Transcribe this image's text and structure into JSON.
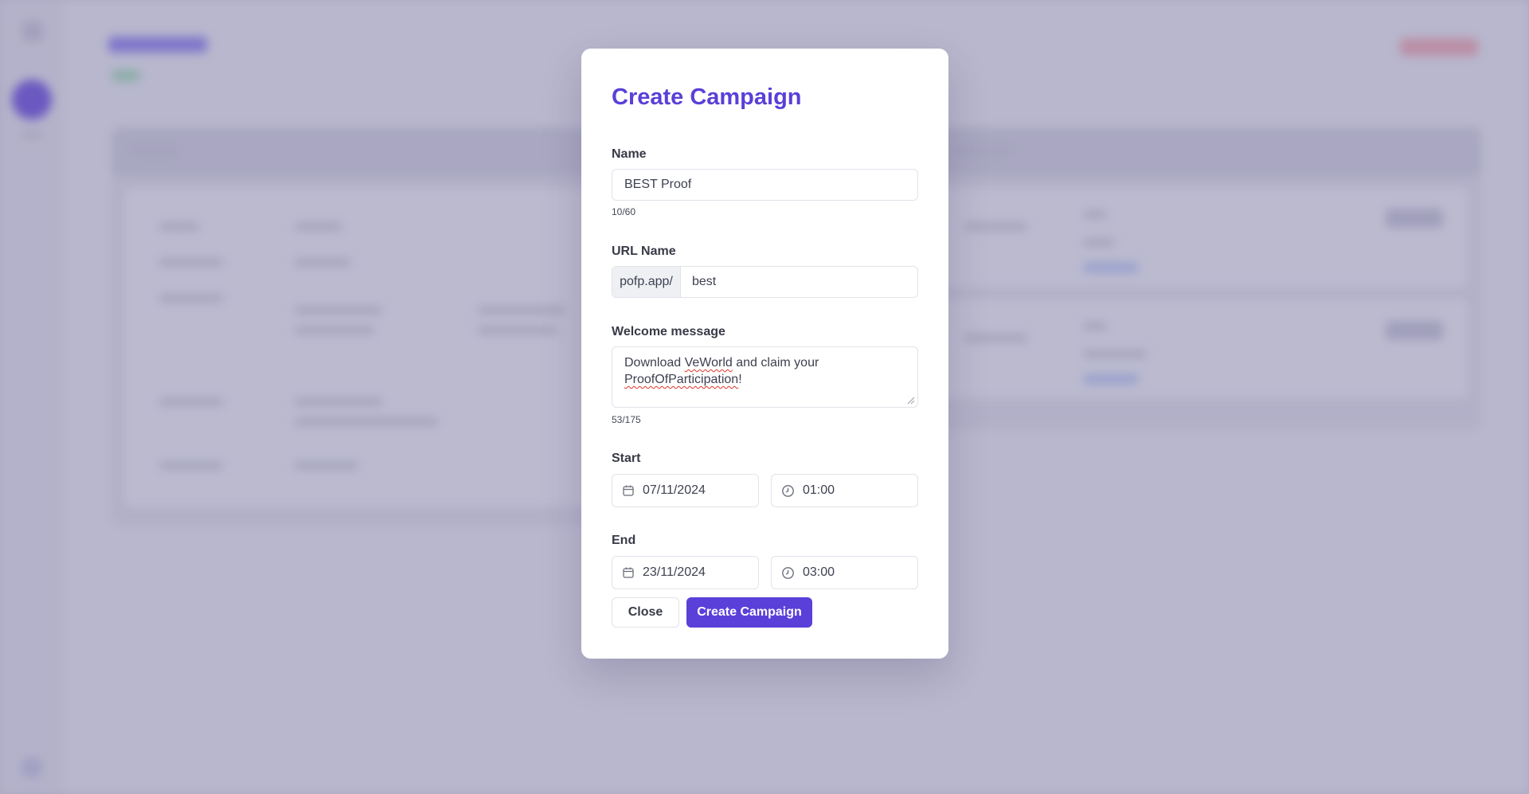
{
  "modal": {
    "title": "Create Campaign",
    "name": {
      "label": "Name",
      "value": "BEST Proof",
      "counter": "10/60"
    },
    "url": {
      "label": "URL Name",
      "prefix": "pofp.app/",
      "value": "best"
    },
    "welcome": {
      "label": "Welcome message",
      "line1_a": "Download ",
      "line1_spell": "VeWorld",
      "line1_b": " and claim your",
      "line2_spell": "ProofOfParticipation",
      "line2_b": "!",
      "counter": "53/175"
    },
    "start": {
      "label": "Start",
      "date": "07/11/2024",
      "time": "01:00"
    },
    "end": {
      "label": "End",
      "date": "23/11/2024",
      "time": "03:00"
    },
    "buttons": {
      "close": "Close",
      "create": "Create Campaign"
    }
  },
  "icons": {
    "date": "calendar-icon",
    "time": "clock-icon"
  },
  "colors": {
    "accent": "#5b3fd9",
    "title": "#5a3fd8",
    "overlay": "#6e6c96"
  }
}
